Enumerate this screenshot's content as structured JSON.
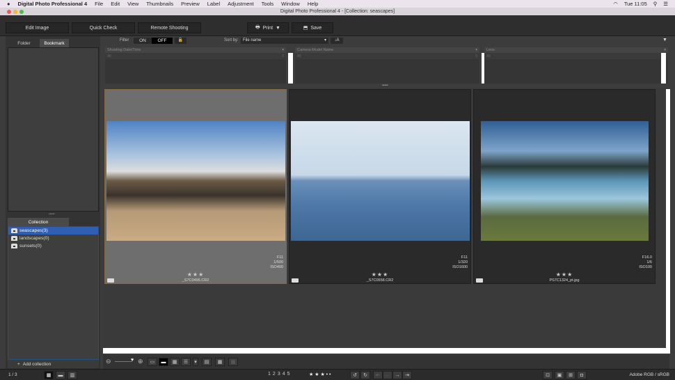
{
  "menubar": {
    "app": "Digital Photo Professional 4",
    "items": [
      "File",
      "Edit",
      "View",
      "Thumbnails",
      "Preview",
      "Label",
      "Adjustment",
      "Tools",
      "Window",
      "Help"
    ],
    "clock": "Tue 11:05"
  },
  "window": {
    "title": "Digital Photo Professional 4 - [Collection: seascapes]"
  },
  "toolbar": {
    "edit_image": "Edit Image",
    "quick_check": "Quick Check",
    "remote_shooting": "Remote Shooting",
    "print": "Print",
    "save": "Save"
  },
  "left": {
    "tabs": [
      "Folder",
      "Bookmark"
    ],
    "collection_tab": "Collection",
    "collections": [
      {
        "label": "seascapes(3)",
        "selected": true
      },
      {
        "label": "landscapes(0)"
      },
      {
        "label": "sunsets(0)"
      }
    ],
    "add_collection": "Add collection"
  },
  "filter": {
    "label": "Filter",
    "on": "ON",
    "off": "OFF",
    "sort_label": "Sort by:",
    "sort_value": "File name",
    "columns": [
      {
        "header": "Shooting Date/Time",
        "all": "All",
        "count": "0"
      },
      {
        "header": "Camera Model Name",
        "all": "All",
        "count": "0"
      },
      {
        "header": "Lens",
        "all": "All",
        "count": "0"
      }
    ]
  },
  "thumbnails": [
    {
      "name": "_S7C0495.CR2",
      "aperture": "F11",
      "shutter": "1/500",
      "iso": "ISO400",
      "stars": "★★★",
      "selected": true
    },
    {
      "name": "_S7C0558.CR2",
      "aperture": "F11",
      "shutter": "1/320",
      "iso": "ISO1600",
      "stars": "★★★"
    },
    {
      "name": "PS7C1324_pt.jpg",
      "aperture": "F16.0",
      "shutter": "1/6",
      "iso": "ISO100",
      "stars": "★★★"
    }
  ],
  "status": {
    "page": "1 / 3",
    "ratings": [
      "1",
      "2",
      "3",
      "4",
      "5"
    ],
    "rating_stars": "★ ★ ★ • •",
    "color_space": "Adobe RGB / sRGB"
  }
}
